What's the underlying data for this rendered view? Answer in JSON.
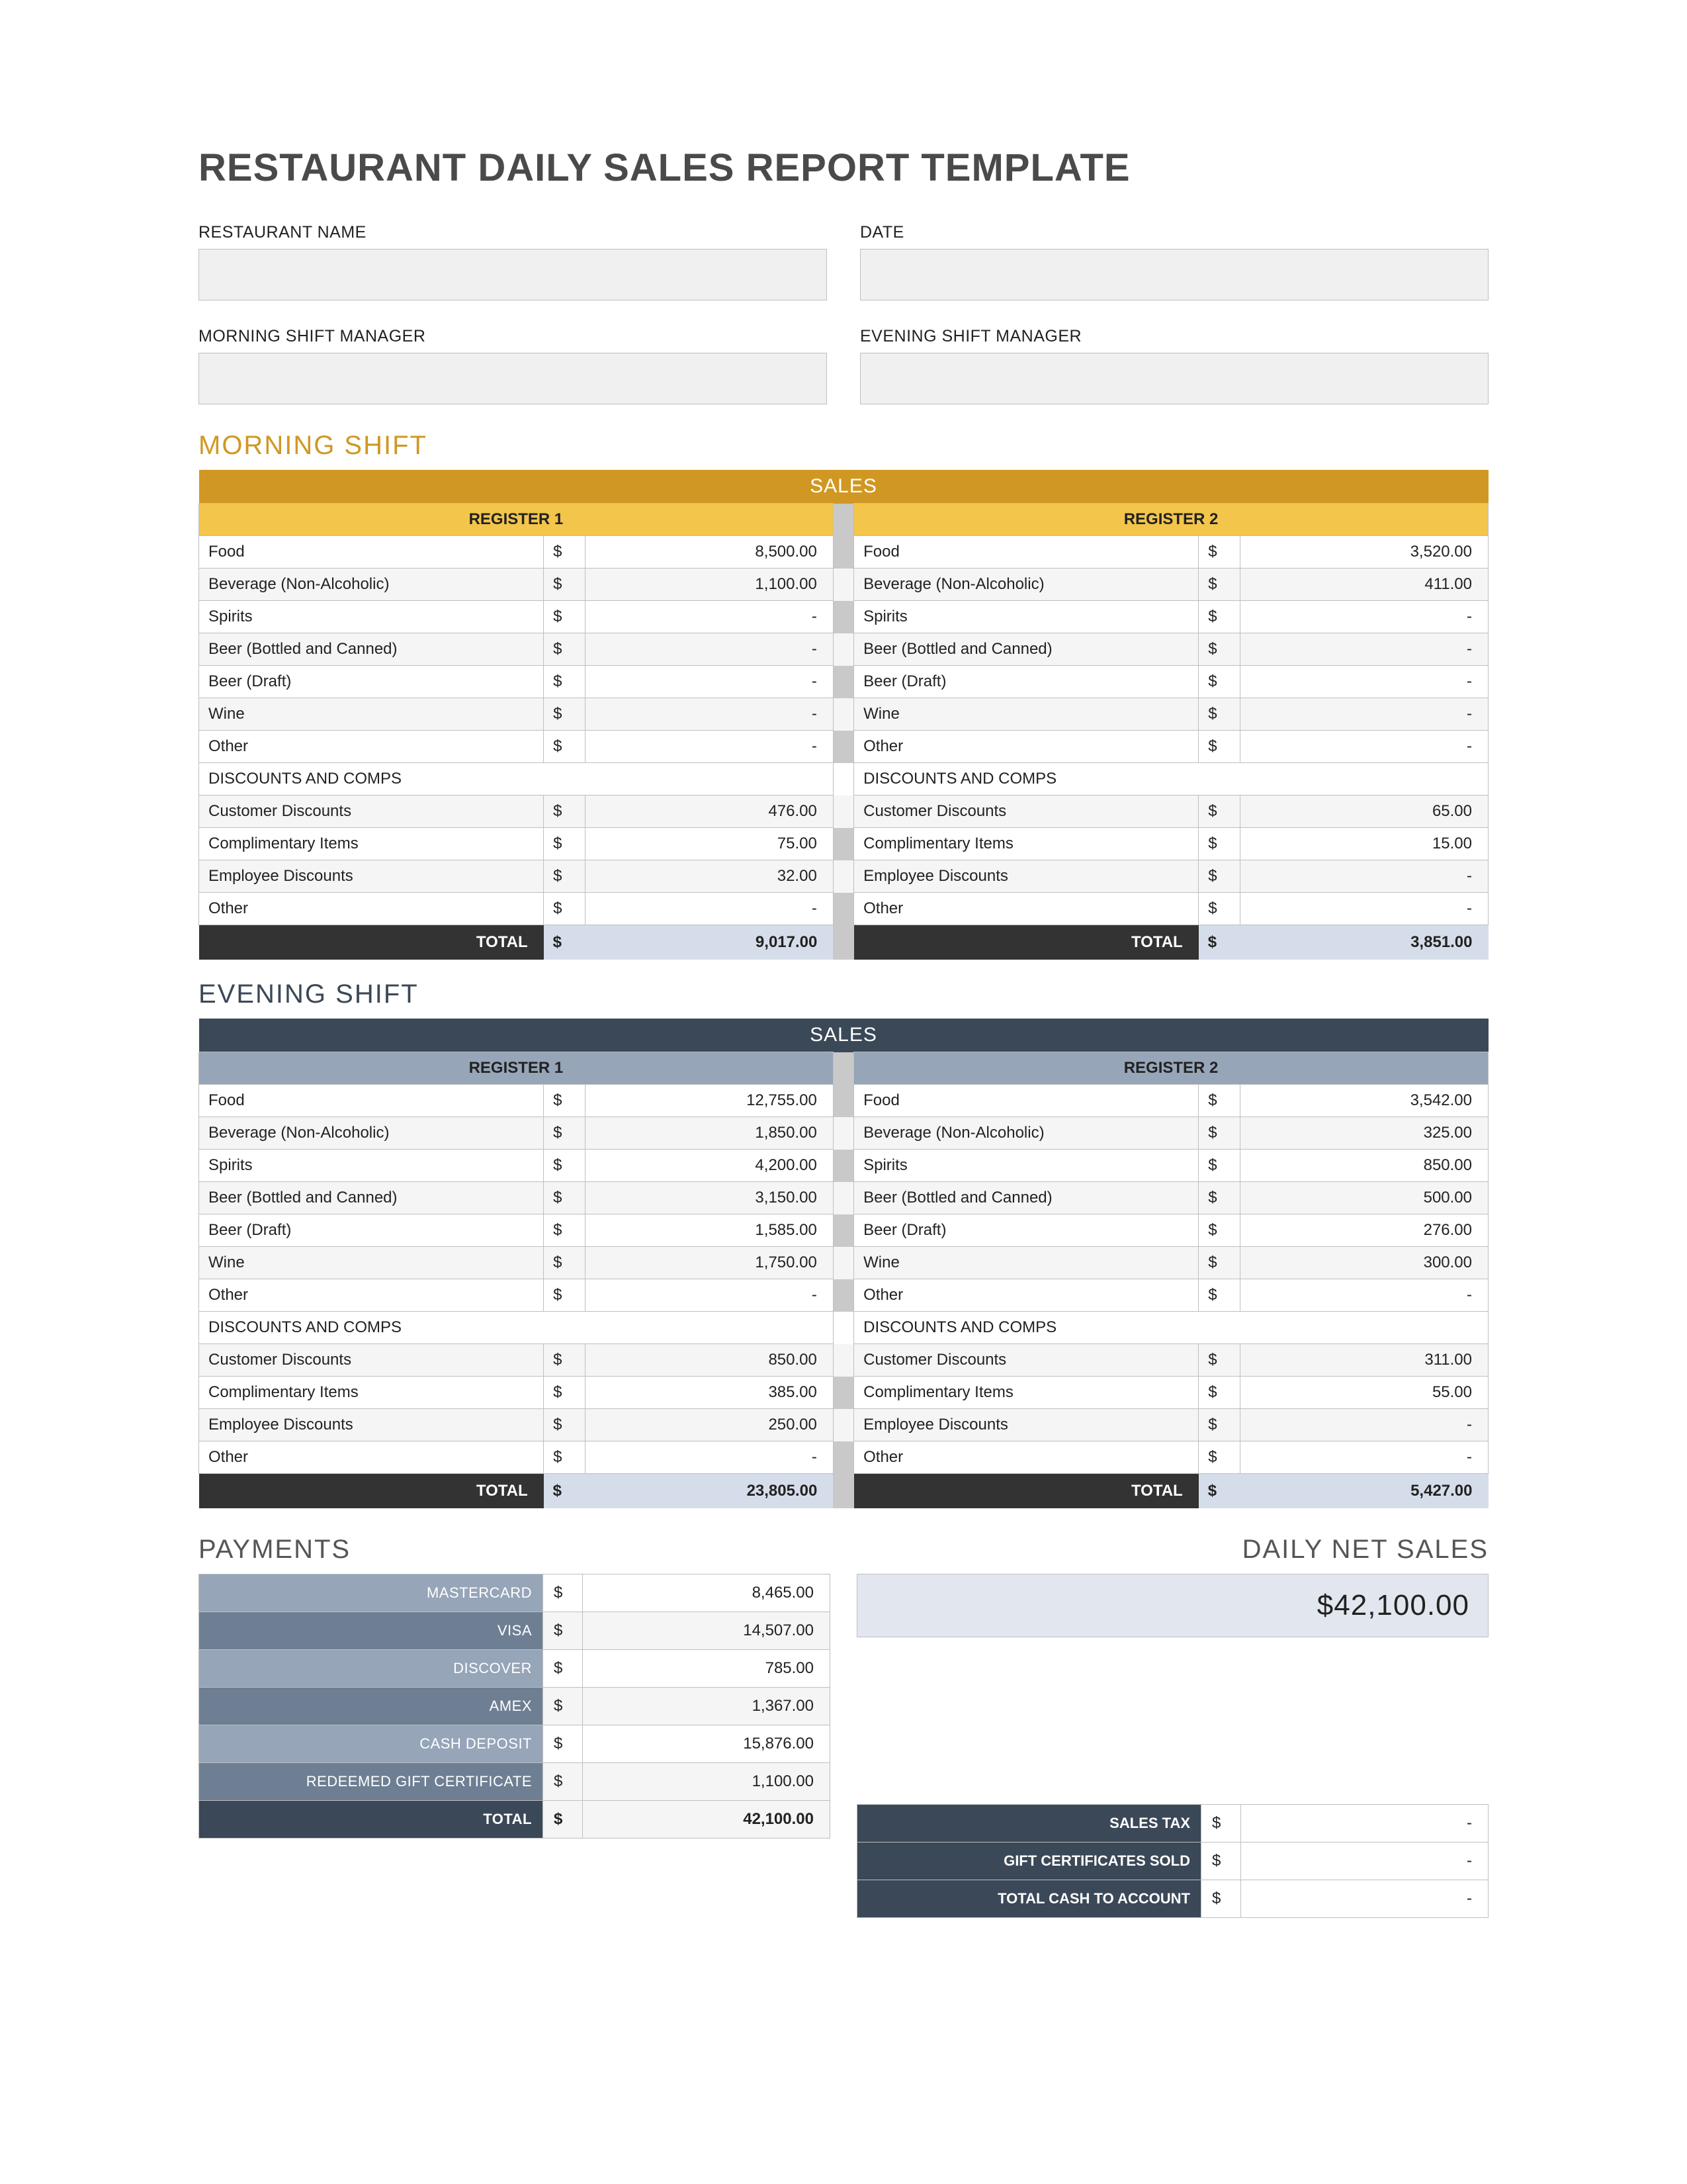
{
  "title": "RESTAURANT DAILY SALES REPORT TEMPLATE",
  "fields": {
    "restaurant_name_label": "RESTAURANT NAME",
    "date_label": "DATE",
    "morning_mgr_label": "MORNING SHIFT MANAGER",
    "evening_mgr_label": "EVENING SHIFT MANAGER",
    "restaurant_name": "",
    "date": "",
    "morning_mgr": "",
    "evening_mgr": ""
  },
  "common": {
    "sales_band": "SALES",
    "register1": "REGISTER 1",
    "register2": "REGISTER 2",
    "cur": "$",
    "dash": "-",
    "discounts_header": "DISCOUNTS AND COMPS",
    "total_label": "TOTAL",
    "row_labels": {
      "food": "Food",
      "bev": "Beverage (Non-Alcoholic)",
      "spirits": "Spirits",
      "beer_bc": "Beer (Bottled and Canned)",
      "beer_draft": "Beer (Draft)",
      "wine": "Wine",
      "other": "Other",
      "cust_disc": "Customer Discounts",
      "comp": "Complimentary Items",
      "emp_disc": "Employee Discounts"
    }
  },
  "morning": {
    "head": "MORNING SHIFT",
    "reg1": {
      "food": "8,500.00",
      "bev": "1,100.00",
      "spirits": "-",
      "beer_bc": "-",
      "beer_draft": "-",
      "wine": "-",
      "other": "-",
      "cust_disc": "476.00",
      "comp": "75.00",
      "emp_disc": "32.00",
      "other_disc": "-",
      "total": "9,017.00"
    },
    "reg2": {
      "food": "3,520.00",
      "bev": "411.00",
      "spirits": "-",
      "beer_bc": "-",
      "beer_draft": "-",
      "wine": "-",
      "other": "-",
      "cust_disc": "65.00",
      "comp": "15.00",
      "emp_disc": "-",
      "other_disc": "-",
      "total": "3,851.00"
    }
  },
  "evening": {
    "head": "EVENING SHIFT",
    "reg1": {
      "food": "12,755.00",
      "bev": "1,850.00",
      "spirits": "4,200.00",
      "beer_bc": "3,150.00",
      "beer_draft": "1,585.00",
      "wine": "1,750.00",
      "other": "-",
      "cust_disc": "850.00",
      "comp": "385.00",
      "emp_disc": "250.00",
      "other_disc": "-",
      "total": "23,805.00"
    },
    "reg2": {
      "food": "3,542.00",
      "bev": "325.00",
      "spirits": "850.00",
      "beer_bc": "500.00",
      "beer_draft": "276.00",
      "wine": "300.00",
      "other": "-",
      "cust_disc": "311.00",
      "comp": "55.00",
      "emp_disc": "-",
      "other_disc": "-",
      "total": "5,427.00"
    }
  },
  "payments": {
    "head": "PAYMENTS",
    "rows": {
      "mastercard": {
        "label": "MASTERCARD",
        "val": "8,465.00"
      },
      "visa": {
        "label": "VISA",
        "val": "14,507.00"
      },
      "discover": {
        "label": "DISCOVER",
        "val": "785.00"
      },
      "amex": {
        "label": "AMEX",
        "val": "1,367.00"
      },
      "cash": {
        "label": "CASH DEPOSIT",
        "val": "15,876.00"
      },
      "gift": {
        "label": "REDEEMED GIFT CERTIFICATE",
        "val": "1,100.00"
      }
    },
    "total_label": "TOTAL",
    "total_val": "42,100.00"
  },
  "net": {
    "head": "DAILY NET SALES",
    "value": "$42,100.00"
  },
  "right_tax": {
    "sales_tax": {
      "label": "SALES TAX",
      "val": "-"
    },
    "gift_sold": {
      "label": "GIFT CERTIFICATES SOLD",
      "val": "-"
    },
    "total_cash": {
      "label": "TOTAL CASH TO ACCOUNT",
      "val": "-"
    }
  }
}
